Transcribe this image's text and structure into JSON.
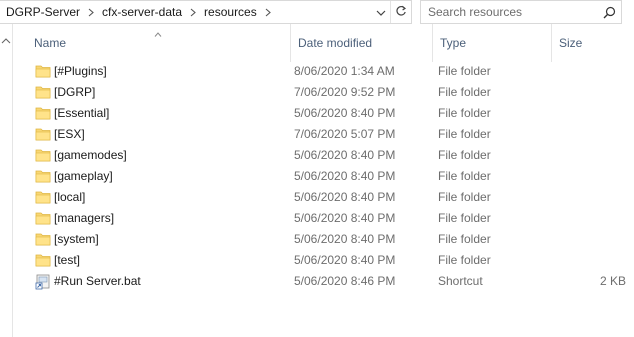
{
  "breadcrumb": [
    {
      "label": "DGRP-Server"
    },
    {
      "label": "cfx-server-data"
    },
    {
      "label": "resources"
    }
  ],
  "search": {
    "placeholder": "Search resources",
    "icon": "search-icon"
  },
  "columns": {
    "name": "Name",
    "date": "Date modified",
    "type": "Type",
    "size": "Size"
  },
  "sort": {
    "column": "name",
    "direction": "ascending"
  },
  "files": [
    {
      "name": "[#Plugins]",
      "date": "8/06/2020 1:34 AM",
      "type": "File folder",
      "size": "",
      "icon": "folder-icon"
    },
    {
      "name": "[DGRP]",
      "date": "7/06/2020 9:52 PM",
      "type": "File folder",
      "size": "",
      "icon": "folder-icon"
    },
    {
      "name": "[Essential]",
      "date": "5/06/2020 8:40 PM",
      "type": "File folder",
      "size": "",
      "icon": "folder-icon"
    },
    {
      "name": "[ESX]",
      "date": "7/06/2020 5:07 PM",
      "type": "File folder",
      "size": "",
      "icon": "folder-icon"
    },
    {
      "name": "[gamemodes]",
      "date": "5/06/2020 8:40 PM",
      "type": "File folder",
      "size": "",
      "icon": "folder-icon"
    },
    {
      "name": "[gameplay]",
      "date": "5/06/2020 8:40 PM",
      "type": "File folder",
      "size": "",
      "icon": "folder-icon"
    },
    {
      "name": "[local]",
      "date": "5/06/2020 8:40 PM",
      "type": "File folder",
      "size": "",
      "icon": "folder-icon"
    },
    {
      "name": "[managers]",
      "date": "5/06/2020 8:40 PM",
      "type": "File folder",
      "size": "",
      "icon": "folder-icon"
    },
    {
      "name": "[system]",
      "date": "5/06/2020 8:40 PM",
      "type": "File folder",
      "size": "",
      "icon": "folder-icon"
    },
    {
      "name": "[test]",
      "date": "5/06/2020 8:40 PM",
      "type": "File folder",
      "size": "",
      "icon": "folder-icon"
    },
    {
      "name": "#Run Server.bat",
      "date": "5/06/2020 8:46 PM",
      "type": "Shortcut",
      "size": "2 KB",
      "icon": "shortcut-icon"
    }
  ],
  "colors": {
    "folder": "#f8d775",
    "folder_dark": "#e0b642",
    "header_text": "#4c607a",
    "meta_text": "#6d6d6d"
  }
}
